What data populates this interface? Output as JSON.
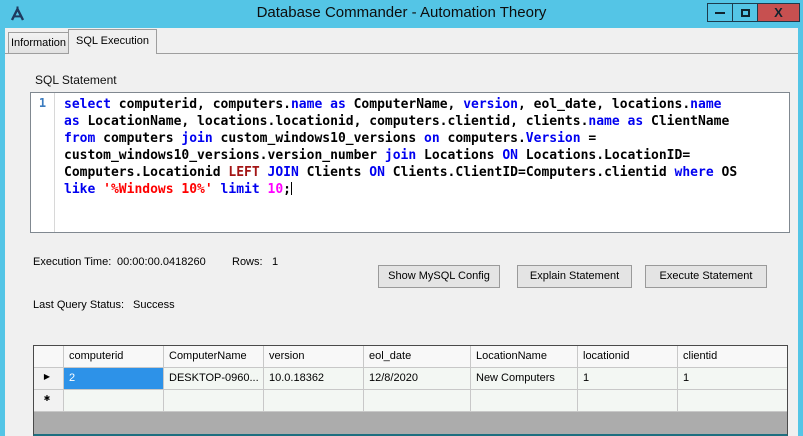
{
  "window": {
    "title": "Database Commander - Automation Theory",
    "close_glyph": "X"
  },
  "tabs": {
    "information": "Information",
    "sql_execution": "SQL Execution"
  },
  "sql": {
    "label": "SQL Statement",
    "line_number": "1",
    "caret": true,
    "lines": [
      [
        {
          "t": "select",
          "c": "kw"
        },
        {
          "t": " computerid, computers.",
          "c": "pl"
        },
        {
          "t": "name",
          "c": "kw"
        },
        {
          "t": " ",
          "c": "pl"
        },
        {
          "t": "as",
          "c": "kw"
        },
        {
          "t": " ComputerName, ",
          "c": "pl"
        },
        {
          "t": "version",
          "c": "kw"
        },
        {
          "t": ", eol_date, locations.",
          "c": "pl"
        },
        {
          "t": "name",
          "c": "kw"
        }
      ],
      [
        {
          "t": "as",
          "c": "kw"
        },
        {
          "t": " LocationName, locations.locationid, computers.clientid, clients.",
          "c": "pl"
        },
        {
          "t": "name",
          "c": "kw"
        },
        {
          "t": " ",
          "c": "pl"
        },
        {
          "t": "as",
          "c": "kw"
        },
        {
          "t": " ClientName",
          "c": "pl"
        }
      ],
      [
        {
          "t": "from",
          "c": "kw"
        },
        {
          "t": " computers ",
          "c": "pl"
        },
        {
          "t": "join",
          "c": "kw"
        },
        {
          "t": " custom_windows10_versions ",
          "c": "pl"
        },
        {
          "t": "on",
          "c": "kw"
        },
        {
          "t": " computers.",
          "c": "pl"
        },
        {
          "t": "Version",
          "c": "kw"
        },
        {
          "t": " =",
          "c": "pl"
        }
      ],
      [
        {
          "t": "custom_windows10_versions.version_number ",
          "c": "pl"
        },
        {
          "t": "join",
          "c": "kw"
        },
        {
          "t": " Locations ",
          "c": "pl"
        },
        {
          "t": "ON",
          "c": "kw"
        },
        {
          "t": " Locations.LocationID=",
          "c": "pl"
        }
      ],
      [
        {
          "t": "Computers.Locationid ",
          "c": "pl"
        },
        {
          "t": "LEFT",
          "c": "kw2"
        },
        {
          "t": " ",
          "c": "pl"
        },
        {
          "t": "JOIN",
          "c": "kw"
        },
        {
          "t": " Clients ",
          "c": "pl"
        },
        {
          "t": "ON",
          "c": "kw"
        },
        {
          "t": " Clients.ClientID=Computers.clientid ",
          "c": "pl"
        },
        {
          "t": "where",
          "c": "kw"
        },
        {
          "t": " OS",
          "c": "pl"
        }
      ],
      [
        {
          "t": "like",
          "c": "kw"
        },
        {
          "t": " ",
          "c": "pl"
        },
        {
          "t": "'%Windows 10%'",
          "c": "str"
        },
        {
          "t": " ",
          "c": "pl"
        },
        {
          "t": "limit",
          "c": "kw"
        },
        {
          "t": " ",
          "c": "pl"
        },
        {
          "t": "10",
          "c": "num"
        },
        {
          "t": ";",
          "c": "pl"
        }
      ]
    ]
  },
  "exec": {
    "time_label": "Execution Time:",
    "time_value": "00:00:00.0418260",
    "rows_label": "Rows:",
    "rows_value": "1"
  },
  "status": {
    "label": "Last Query Status:",
    "value": "Success"
  },
  "actions": {
    "show_config": "Show MySQL Config",
    "explain": "Explain Statement",
    "execute": "Execute Statement"
  },
  "table": {
    "columns": [
      "computerid",
      "ComputerName",
      "version",
      "eol_date",
      "LocationName",
      "locationid",
      "clientid"
    ],
    "rows": [
      [
        "2",
        "DESKTOP-0960...",
        "10.0.18362",
        "12/8/2020",
        "New Computers",
        "1",
        "1"
      ]
    ],
    "row_marker": "▶",
    "new_row_marker": "✱"
  },
  "colors": {
    "titlebar": "#54C5E6",
    "close_button": "#C75050",
    "selection": "#2D92E8",
    "keyword": "#0000F0",
    "keyword_alt": "#A31515",
    "string": "#FF0000",
    "number": "#FF00FF"
  }
}
